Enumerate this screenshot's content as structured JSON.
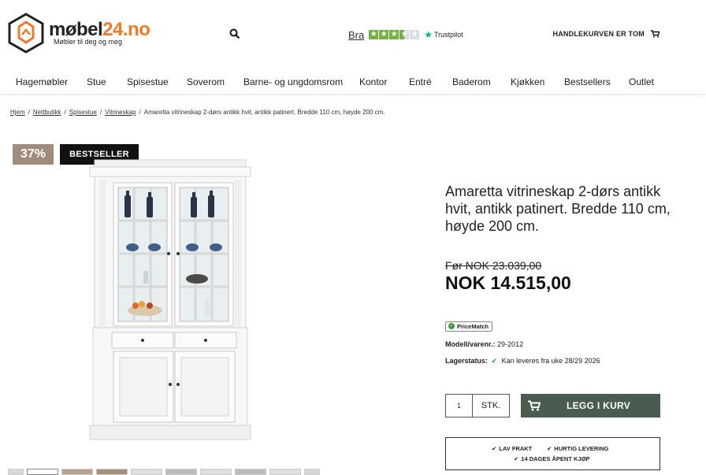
{
  "header": {
    "logo_name_main": "møbel",
    "logo_name_accent": "24.no",
    "logo_tagline": "Møbler til deg og meg",
    "trustpilot_rating_text": "Bra",
    "trustpilot_brand": "Trustpilot",
    "trustpilot_stars": 3.5,
    "cart_label": "HANDLEKURVEN ER TOM"
  },
  "nav": {
    "items": [
      "Hagemøbler",
      "Stue",
      "Spisestue",
      "Soverom",
      "Barne- og ungdomsrom",
      "Kontor",
      "Entré",
      "Baderom",
      "Kjøkken",
      "Bestsellers",
      "Outlet"
    ]
  },
  "breadcrumb": {
    "links": [
      "Hjem",
      "Nettbutikk",
      "Spisestue",
      "Vitrineskap"
    ],
    "current": "Amaretta vitrineskap 2-dørs antikk hvit, antikk patinert. Bredde 110 cm, høyde 200 cm."
  },
  "badges": {
    "discount": "37%",
    "bestseller": "BESTSELLER"
  },
  "product": {
    "title": "Amaretta vitrineskap 2-dørs antikk hvit, antikk patinert. Bredde 110 cm, høyde 200 cm.",
    "old_price": "Før NOK 23.039,00",
    "price": "NOK 14.515,00",
    "pricematch": "PriceMatch",
    "model_label": "Modell/varenr.:",
    "model_value": "29-2012",
    "stock_label": "Lagerstatus:",
    "stock_value": "Kan leveres fra uke 28/29 2026"
  },
  "purchase": {
    "quantity": "1",
    "unit": "STK.",
    "add_to_cart": "LEGG I KURV"
  },
  "usps": [
    "LAV FRAKT",
    "HURTIG LEVERING",
    "14 DAGES ÅPENT KJØP"
  ],
  "colors": {
    "logo_accent": "#f07a2a",
    "discount_badge": "#a08c7d",
    "bestseller_badge": "#111111",
    "add_to_cart_bg": "#485c50",
    "trustpilot_green": "#73b143",
    "check_green": "#3a9a3a"
  }
}
